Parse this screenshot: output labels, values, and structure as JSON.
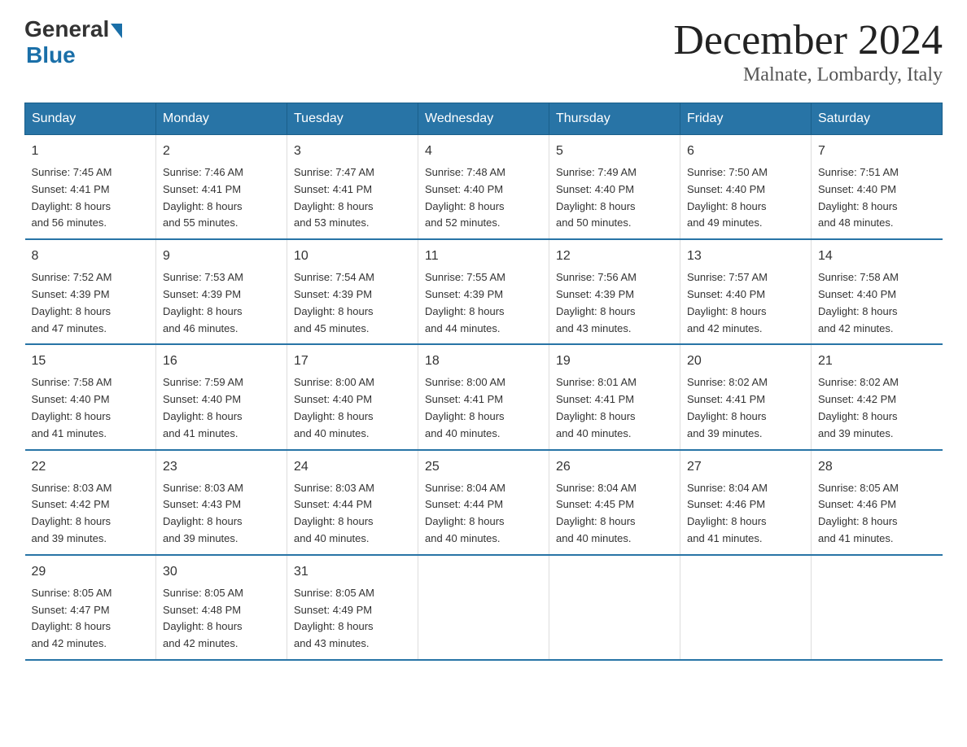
{
  "logo": {
    "general": "General",
    "blue": "Blue"
  },
  "title": {
    "month_year": "December 2024",
    "location": "Malnate, Lombardy, Italy"
  },
  "days_of_week": [
    "Sunday",
    "Monday",
    "Tuesday",
    "Wednesday",
    "Thursday",
    "Friday",
    "Saturday"
  ],
  "weeks": [
    [
      {
        "day": "1",
        "sunrise": "7:45 AM",
        "sunset": "4:41 PM",
        "daylight": "8 hours and 56 minutes."
      },
      {
        "day": "2",
        "sunrise": "7:46 AM",
        "sunset": "4:41 PM",
        "daylight": "8 hours and 55 minutes."
      },
      {
        "day": "3",
        "sunrise": "7:47 AM",
        "sunset": "4:41 PM",
        "daylight": "8 hours and 53 minutes."
      },
      {
        "day": "4",
        "sunrise": "7:48 AM",
        "sunset": "4:40 PM",
        "daylight": "8 hours and 52 minutes."
      },
      {
        "day": "5",
        "sunrise": "7:49 AM",
        "sunset": "4:40 PM",
        "daylight": "8 hours and 50 minutes."
      },
      {
        "day": "6",
        "sunrise": "7:50 AM",
        "sunset": "4:40 PM",
        "daylight": "8 hours and 49 minutes."
      },
      {
        "day": "7",
        "sunrise": "7:51 AM",
        "sunset": "4:40 PM",
        "daylight": "8 hours and 48 minutes."
      }
    ],
    [
      {
        "day": "8",
        "sunrise": "7:52 AM",
        "sunset": "4:39 PM",
        "daylight": "8 hours and 47 minutes."
      },
      {
        "day": "9",
        "sunrise": "7:53 AM",
        "sunset": "4:39 PM",
        "daylight": "8 hours and 46 minutes."
      },
      {
        "day": "10",
        "sunrise": "7:54 AM",
        "sunset": "4:39 PM",
        "daylight": "8 hours and 45 minutes."
      },
      {
        "day": "11",
        "sunrise": "7:55 AM",
        "sunset": "4:39 PM",
        "daylight": "8 hours and 44 minutes."
      },
      {
        "day": "12",
        "sunrise": "7:56 AM",
        "sunset": "4:39 PM",
        "daylight": "8 hours and 43 minutes."
      },
      {
        "day": "13",
        "sunrise": "7:57 AM",
        "sunset": "4:40 PM",
        "daylight": "8 hours and 42 minutes."
      },
      {
        "day": "14",
        "sunrise": "7:58 AM",
        "sunset": "4:40 PM",
        "daylight": "8 hours and 42 minutes."
      }
    ],
    [
      {
        "day": "15",
        "sunrise": "7:58 AM",
        "sunset": "4:40 PM",
        "daylight": "8 hours and 41 minutes."
      },
      {
        "day": "16",
        "sunrise": "7:59 AM",
        "sunset": "4:40 PM",
        "daylight": "8 hours and 41 minutes."
      },
      {
        "day": "17",
        "sunrise": "8:00 AM",
        "sunset": "4:40 PM",
        "daylight": "8 hours and 40 minutes."
      },
      {
        "day": "18",
        "sunrise": "8:00 AM",
        "sunset": "4:41 PM",
        "daylight": "8 hours and 40 minutes."
      },
      {
        "day": "19",
        "sunrise": "8:01 AM",
        "sunset": "4:41 PM",
        "daylight": "8 hours and 40 minutes."
      },
      {
        "day": "20",
        "sunrise": "8:02 AM",
        "sunset": "4:41 PM",
        "daylight": "8 hours and 39 minutes."
      },
      {
        "day": "21",
        "sunrise": "8:02 AM",
        "sunset": "4:42 PM",
        "daylight": "8 hours and 39 minutes."
      }
    ],
    [
      {
        "day": "22",
        "sunrise": "8:03 AM",
        "sunset": "4:42 PM",
        "daylight": "8 hours and 39 minutes."
      },
      {
        "day": "23",
        "sunrise": "8:03 AM",
        "sunset": "4:43 PM",
        "daylight": "8 hours and 39 minutes."
      },
      {
        "day": "24",
        "sunrise": "8:03 AM",
        "sunset": "4:44 PM",
        "daylight": "8 hours and 40 minutes."
      },
      {
        "day": "25",
        "sunrise": "8:04 AM",
        "sunset": "4:44 PM",
        "daylight": "8 hours and 40 minutes."
      },
      {
        "day": "26",
        "sunrise": "8:04 AM",
        "sunset": "4:45 PM",
        "daylight": "8 hours and 40 minutes."
      },
      {
        "day": "27",
        "sunrise": "8:04 AM",
        "sunset": "4:46 PM",
        "daylight": "8 hours and 41 minutes."
      },
      {
        "day": "28",
        "sunrise": "8:05 AM",
        "sunset": "4:46 PM",
        "daylight": "8 hours and 41 minutes."
      }
    ],
    [
      {
        "day": "29",
        "sunrise": "8:05 AM",
        "sunset": "4:47 PM",
        "daylight": "8 hours and 42 minutes."
      },
      {
        "day": "30",
        "sunrise": "8:05 AM",
        "sunset": "4:48 PM",
        "daylight": "8 hours and 42 minutes."
      },
      {
        "day": "31",
        "sunrise": "8:05 AM",
        "sunset": "4:49 PM",
        "daylight": "8 hours and 43 minutes."
      },
      null,
      null,
      null,
      null
    ]
  ],
  "labels": {
    "sunrise": "Sunrise:",
    "sunset": "Sunset:",
    "daylight": "Daylight:"
  }
}
